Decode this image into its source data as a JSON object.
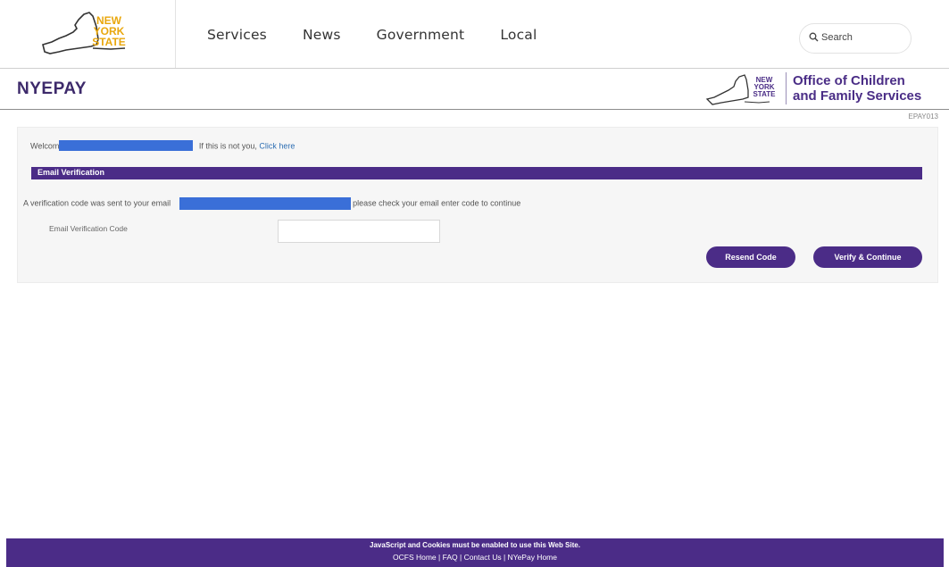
{
  "header": {
    "logo_lines": [
      "NEW",
      "YORK",
      "STATE"
    ],
    "nav": [
      {
        "label": "Services"
      },
      {
        "label": "News"
      },
      {
        "label": "Government"
      },
      {
        "label": "Local"
      }
    ],
    "search": {
      "placeholder": "Search",
      "icon": "search-icon"
    }
  },
  "subheader": {
    "app_title": "NYEPAY",
    "agency_logo_lines": [
      "NEW",
      "YORK",
      "STATE"
    ],
    "agency_name_line1": "Office of Children",
    "agency_name_line2": "and Family Services",
    "page_code": "EPAY013"
  },
  "panel": {
    "welcome_prefix": "Welcom",
    "welcome_suffix": "If this is not you,",
    "welcome_link": "Click here",
    "section_title": "Email Verification",
    "message_prefix": "A verification code was sent to your email",
    "message_suffix": "please check your email enter code to continue",
    "code_label": "Email Verification Code",
    "code_value": "",
    "resend_label": "Resend Code",
    "verify_label": "Verify & Continue"
  },
  "footer": {
    "note": "JavaScript and Cookies must be enabled to use this Web Site.",
    "links": [
      "OCFS Home",
      "FAQ",
      "Contact Us",
      "NYePay Home"
    ],
    "separator": " | "
  },
  "colors": {
    "brand_purple": "#4b2c87",
    "title_purple": "#3d2a6b",
    "logo_gold": "#e9a70d",
    "redaction_blue": "#3a6fd8"
  }
}
